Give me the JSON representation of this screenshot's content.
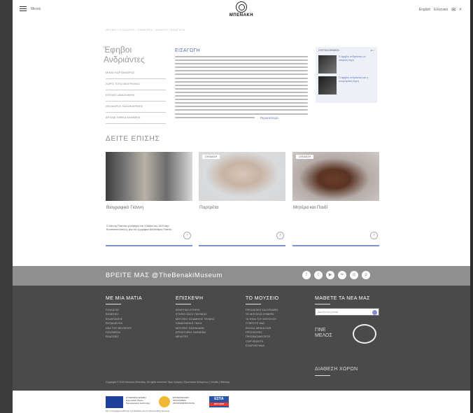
{
  "header": {
    "menu_label": "Μενού",
    "logo_text": "ΜΠΕΝΑΚΗ",
    "lang_en": "English",
    "lang_gr": "Ελληνικά"
  },
  "breadcrumb": "ΑΡΧΙΚΗ / ΣΥΛΛΟΓΕΣ / ΕΚΘΕΣΕΙΣ / ΕΚΘΕΣΗ / ΕΙΣΑΓΩΓΗ",
  "sidebar": {
    "title": "Έφηβοι Ανδριάντες",
    "items": [
      "ΜΠΙΑΤ ΚΑΡΤΑΙΝΟΡΟΣ",
      "ΧΩΡΙΣ ΤΙΤΛΟ ΒΙΟΓΡΑΦΙΑΣ",
      "ΕΠΟΧΕΣ ΑΝΑΣΚΑΦΗΣ",
      "ΘΕΟΔΩΡΟΣ ΚΑΛΟΚΑΙΡΙΝΗΣ",
      "ΑΡΧΑΙΑ ΤΑΦΙΚΑ ΜΝΗΜΕΙΑ"
    ]
  },
  "article": {
    "title": "ΕΙΣΑΓΩΓΗ",
    "more": "Περισσότερα"
  },
  "related": {
    "head": "ΣΧΕΤΙΚΑ ΘΕΜΑΤΑ",
    "items": [
      "Ο έφηβος ανδριάντας ως ιστορική πηγή",
      "Ο έφηβος ανδριάντας και η αναμνηστική τέχνη"
    ]
  },
  "see_also": {
    "title": "ΔΕΙΤΕ ΕΠΙΣΗΣ",
    "cards": [
      {
        "tag": "",
        "caption": "Βιογραφικό Γιάννη",
        "desc": "Ο Γιάννης Παππάς γεννήθηκε στις 3 Μαΐου του 1913 στην Κωνσταντινούπολη, γιος του ζωγράφου Αλέξανδρου Παππά."
      },
      {
        "tag": "ΣΧΕΔΙΑΣΗ",
        "caption": "Πορτρέτα",
        "desc": ""
      },
      {
        "tag": "ΣΧΕΔΙΑΣΗ",
        "caption": "Μητέρα και Παιδί",
        "desc": ""
      }
    ]
  },
  "find_us": "ΒΡΕΙΤΕ ΜΑΣ @TheBenakiMuseum",
  "footer": {
    "cols": [
      {
        "head": "ΜΕ ΜΙΑ ΜΑΤΙΑ",
        "items": [
          "ΣΥΛΛΟΓΕΣ",
          "ΕΚΘΕΣΕΙΣ",
          "ΕΚΔΗΛΩΣΕΙΣ",
          "ΕΚΠΑΙΔΕΥΣΗ",
          "ΝΕΑ ΤΟΥ ΜΟΥΣΕΙΟΥ",
          "ΠΟΛΥΜΕΣΑ",
          "ΕΚΔΟΣΕΙΣ"
        ]
      },
      {
        "head": "ΕΠΙΣΚΕΨΗ",
        "items": [
          "ΚΕΝΤΡΙΚΟ ΚΤΗΡΙΟ",
          "ΚΤΗΡΙΟ ΟΔΟΥ ΠΕΙΡΑΙΩΣ",
          "ΜΟΥΣΕΙΟ ΙΣΛΑΜΙΚΗΣ ΤΕΧΝΗΣ",
          "ΠΙΝΑΚΟΘΗΚΗ ΓΚΙΚΑ",
          "ΜΟΥΣΕΙΟ ΠΑΙΧΝΙΔΙΩΝ",
          "ΕΡΓΑΣΤΗΡΙΟ ΠΑΡΘΕΝΗ",
          "ΜΕΛΕΤΕΣ"
        ]
      },
      {
        "head": "ΤΟ ΜΟΥΣΕΙΟ",
        "items": [
          "ΠΡΟΣΩΠΙΚΟ ΚΑΙ ΕΠΑΦΕΣ",
          "ΤΟ ΜΟΥΣΕΙΟ ΣΗΜΕΡΑ",
          "ΤΑ ΦΙΛΑ ΤΟΥ ΜΟΥΣΕΙΟΥ",
          "ΣΤΗΡΙΞΤΕ ΜΑΣ",
          "SOCIAL MEDIA HUB",
          "ΠΡΟΣΦΟΡΕΣ",
          "ΠΡΟΣΒΑΣΙΜΟΤΗΤΑ",
          "COPYRIGHTS",
          "ΕΤΑΙΡΟΚΤΗΜΑ"
        ]
      }
    ],
    "newsletter_head": "ΜΑΘΕΤΕ ΤΑ ΝΕΑ ΜΑΣ",
    "newsletter_placeholder": "Διεύθυνση email",
    "member": "ΓΙΝΕ ΜΕΛΟΣ",
    "space": "ΔΙΑΘΕΣΗ ΧΩΡΩΝ",
    "copyright": "Copyright © 2016 Μουσείο Μπενάκη. All rights reserved. Όροι Χρήσης | Προστασία δεδομένων | Credits | Sitemap"
  },
  "eu": {
    "flag_text": "ΕΥΡΩΠΑΪΚΗ ΕΝΩΣΗ Ευρωπαϊκό Ταμείο Περιφερειακής Ανάπτυξης",
    "program_text": "ΕΠΙΧΕΙΡΗΣΙΑΚΟ ΠΡΟΓΡΑΜΜΑ ΑΝΤΑΓΩΝΙΣΤΙΚΟΤΗΤΑ",
    "espa": "ΕΣΠΑ",
    "espa_years": "2014-2020",
    "footer_text": "Με τη συγχρηματοδότηση της Ελλάδας και της Ευρωπαϊκής Ένωσης"
  },
  "colors": {
    "accent": "#5a6fb5",
    "footer": "#4a4a4a",
    "strip": "#8f8f8f"
  },
  "icons": [
    "menu-icon",
    "mail-icon",
    "search-icon",
    "facebook-icon",
    "twitter-icon",
    "youtube-icon",
    "flickr-icon",
    "instagram-icon",
    "pinterest-icon"
  ]
}
